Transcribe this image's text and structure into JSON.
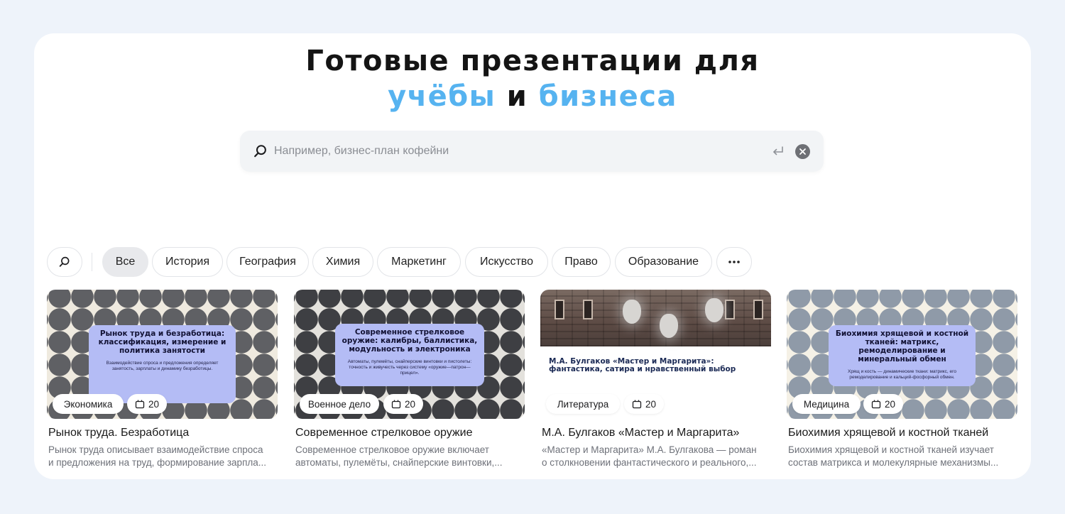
{
  "hero": {
    "title_line1": "Готовые презентации для",
    "title_accent1": "учёбы",
    "title_conj": "и",
    "title_accent2": "бизнеса",
    "accent_color": "#56b3f0"
  },
  "search": {
    "placeholder": "Например, бизнес-план кофейни",
    "value": "",
    "icon": "search-icon",
    "enter_icon": "enter-icon",
    "clear_icon": "close-icon"
  },
  "filters": {
    "search_icon": "search-icon",
    "chips": [
      "Все",
      "История",
      "География",
      "Химия",
      "Маркетинг",
      "Искусство",
      "Право",
      "Образование"
    ],
    "active": "Все",
    "more_icon": "more-icon"
  },
  "cards": [
    {
      "slide_title": "Рынок труда и безработица: классификация, измерение и политика занятости",
      "slide_sub": "Взаимодействие спроса и предложения определяет занятость, зарплаты и динамику безработицы.",
      "tag": "Экономика",
      "slides_count": "20",
      "title": "Рынок труда. Безработица",
      "desc_line1": "Рынок труда описывает взаимодействие спроса",
      "desc_line2": "и предложения на труд, формирование зарпла..."
    },
    {
      "slide_title": "Современное стрелковое оружие: калибры, баллистика, модульность и электроника",
      "slide_sub": "Автоматы, пулемёты, снайперские винтовки и пистолеты: точность и живучесть через систему «оружие—патрон—прицел».",
      "tag": "Военное дело",
      "slides_count": "20",
      "title": "Современное стрелковое оружие",
      "desc_line1": "Современное стрелковое оружие включает",
      "desc_line2": "автоматы, пулемёты, снайперские винтовки,..."
    },
    {
      "slide_title": "М.А. Булгаков «Мастер и Маргарита»: фантастика, сатира и нравственный выбор",
      "tag": "Литература",
      "slides_count": "20",
      "title": "М.А. Булгаков «Мастер и Маргарита»",
      "desc_line1": "«Мастер и Маргарита» М.А. Булгакова — роман",
      "desc_line2": "о столкновении фантастического и реального,..."
    },
    {
      "slide_title": "Биохимия хрящевой и костной тканей: матрикс, ремоделирование и минеральный обмен",
      "slide_sub": "Хрящ и кость — динамические ткани: матрикс, его ремоделирование и кальций-фосфорный обмен.",
      "tag": "Медицина",
      "slides_count": "20",
      "title": "Биохимия хрящевой и костной тканей",
      "desc_line1": "Биохимия хрящевой и костной тканей изучает",
      "desc_line2": "состав матрикса и молекулярные механизмы..."
    }
  ]
}
